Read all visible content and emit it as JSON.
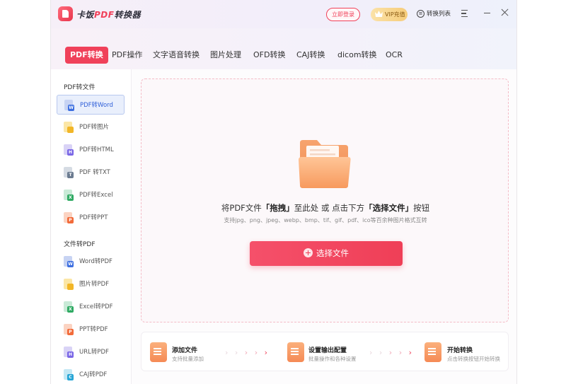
{
  "app": {
    "title_prefix": "卡饭",
    "title_pdf": "PDF",
    "title_suffix": "转换器",
    "login_label": "立即登录",
    "vip_label": "VIP充值",
    "convert_list_label": "转换列表",
    "icons": [
      "app-logo-icon",
      "crown-icon",
      "list-icon",
      "menu-icon",
      "minimize-icon",
      "close-icon"
    ]
  },
  "tabs": [
    {
      "label": "PDF转换",
      "active": true
    },
    {
      "label": "PDF操作"
    },
    {
      "label": "文字语音转换"
    },
    {
      "label": "图片处理"
    },
    {
      "label": "OFD转换"
    },
    {
      "label": "CAJ转换"
    },
    {
      "label": "dicom转换"
    },
    {
      "label": "OCR"
    }
  ],
  "sidebar": {
    "section1_title": "PDF转文件",
    "section1_items": [
      {
        "label": "PDF转Word",
        "badge": "W",
        "active": true
      },
      {
        "label": "PDF转图片",
        "badge": ""
      },
      {
        "label": "PDF转HTML",
        "badge": "H"
      },
      {
        "label": "PDF 转TXT",
        "badge": "T"
      },
      {
        "label": "PDF转Excel",
        "badge": "X"
      },
      {
        "label": "PDF转PPT",
        "badge": "P"
      }
    ],
    "section2_title": "文件转PDF",
    "section2_items": [
      {
        "label": "Word转PDF",
        "badge": "W"
      },
      {
        "label": "图片转PDF",
        "badge": ""
      },
      {
        "label": "Excel转PDF",
        "badge": "X"
      },
      {
        "label": "PPT转PDF",
        "badge": "P"
      },
      {
        "label": "URL转PDF",
        "badge": "H"
      },
      {
        "label": "CAJ转PDF",
        "badge": "C"
      }
    ]
  },
  "dropzone": {
    "text_1": "将PDF文件",
    "text_bold_1": "「拖拽」",
    "text_2": "至此处 或 点击下方",
    "text_bold_2": "「选择文件」",
    "text_3": "按钮",
    "subtitle": "支持jpg、png、jpeg、webp、bmp、tif、gif、pdf、ico等百余种图片格式互转",
    "button_label": "选择文件"
  },
  "steps": [
    {
      "title": "添加文件",
      "desc": "支持批量添加"
    },
    {
      "title": "设置输出配置",
      "desc": "批量操作和各种设置"
    },
    {
      "title": "开始转换",
      "desc": "点击转换按钮开始转换"
    }
  ],
  "colors": {
    "accent": "#f0415a",
    "active_blue": "#2f5fd8",
    "step_orange": "#f58a55"
  }
}
